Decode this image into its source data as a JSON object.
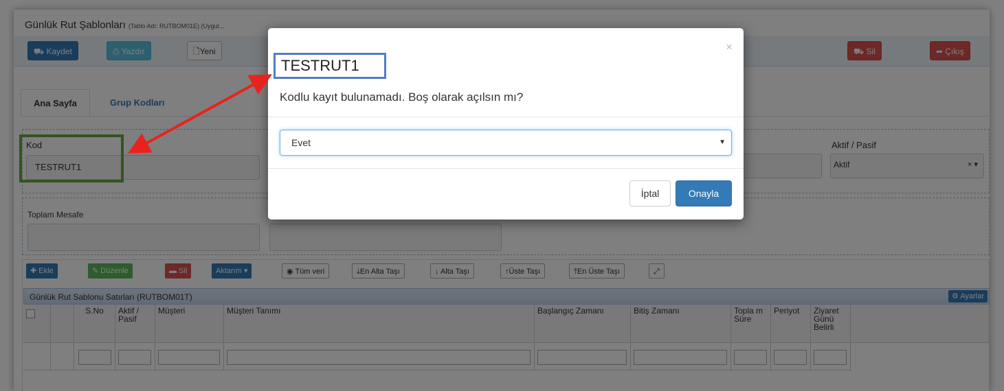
{
  "page": {
    "title": "Günlük Rut Şablonları",
    "subtitle": "(Tablo Adı: RUTBOM01E) (Uygul..."
  },
  "toolbar": {
    "save": "Kaydet",
    "print": "Yazdır",
    "new": "Yeni",
    "delete": "Sil",
    "exit": "Çıkış"
  },
  "tabs": [
    "Ana Sayfa",
    "Grup Kodları"
  ],
  "form": {
    "kod_label": "Kod",
    "kod_value": "TESTRUT1",
    "aktif_label": "Aktif / Pasif",
    "aktif_value": "Aktif",
    "clear_glyph": "× ▾",
    "toplam_label": "Toplam Mesafe"
  },
  "grid": {
    "buttons": {
      "add": "Ekle",
      "edit": "Düzenle",
      "delete": "Sil",
      "transfer": "Aktarım ▾",
      "all_data": "Tüm veri",
      "move_bottom": "En Alta Taşı",
      "move_down": "Alta Taşı",
      "move_up": "Üste Taşı",
      "move_top": "En Üste Taşı"
    },
    "caption": "Günlük Rut Sablonu Satırları (RUTBOM01T)",
    "settings": "Ayarlar",
    "columns": [
      "S.No",
      "Aktif / Pasif",
      "Müşteri",
      "Müşteri Tanımı",
      "Başlangıç Zamanı",
      "Bitiş Zamanı",
      "Topla m Süre",
      "Periyot",
      "Ziyaret Günü Belirli"
    ]
  },
  "modal": {
    "title": "TESTRUT1",
    "message": "Kodlu kayıt bulunamadı. Boş olarak açılsın mı?",
    "select_value": "Evet",
    "cancel": "İptal",
    "confirm": "Onayla",
    "close": "×"
  },
  "colors": {
    "primary": "#337ab7",
    "danger": "#d9534f",
    "success": "#5cb85c",
    "info": "#5bc0de",
    "highlight_green": "#6aa63e",
    "highlight_blue": "#4f7ec1",
    "arrow": "#e8231e"
  }
}
